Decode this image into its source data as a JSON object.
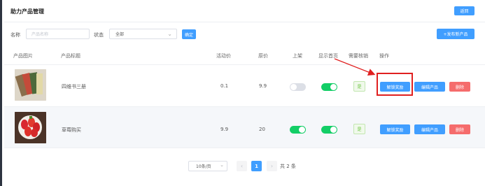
{
  "header": {
    "title": "助力产品管理",
    "back_label": "返回"
  },
  "filters": {
    "name_label": "名称",
    "name_placeholder": "产品名称",
    "status_label": "状态",
    "status_value": "全部",
    "confirm_label": "确定",
    "publish_label": "+发布新产品"
  },
  "table": {
    "headers": [
      "产品图片",
      "产品标题",
      "活动价",
      "原价",
      "上架",
      "显示首页",
      "需要核销",
      "操作"
    ],
    "rows": [
      {
        "image_icon": "book-set-image",
        "title": "四维书三册",
        "activity_price": "0.1",
        "original_price": "9.9",
        "on_shelf": false,
        "show_home": true,
        "need_verify": "是",
        "actions": [
          "解锁奖励",
          "编辑产品",
          "删除"
        ]
      },
      {
        "image_icon": "strawberry-image",
        "title": "草莓购买",
        "activity_price": "9.9",
        "original_price": "20",
        "on_shelf": true,
        "show_home": true,
        "need_verify": "是",
        "actions": [
          "解锁奖励",
          "编辑产品",
          "删除"
        ]
      }
    ]
  },
  "pagination": {
    "page_size_label": "10条/页",
    "prev_icon": "chevron-left-icon",
    "next_icon": "chevron-right-icon",
    "current_page": "1",
    "total_label": "共 2 条"
  },
  "colors": {
    "primary": "#409eff",
    "danger": "#f56c6c",
    "success": "#13ce66",
    "annotation": "#e02020"
  }
}
